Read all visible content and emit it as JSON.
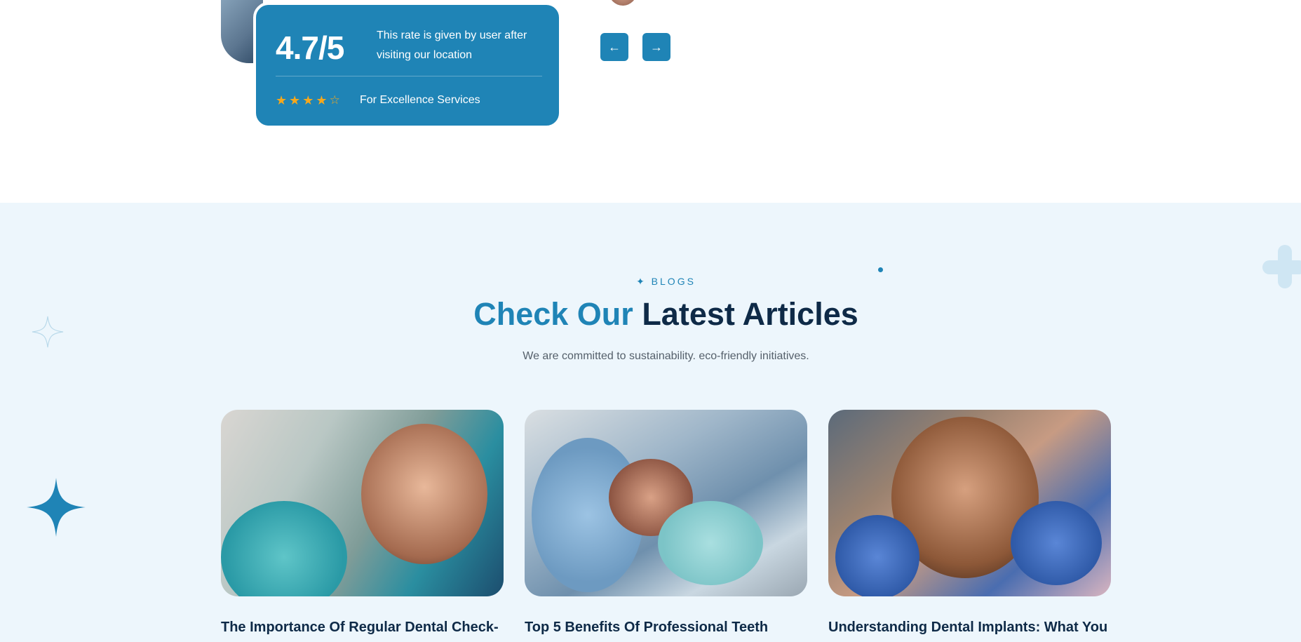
{
  "rating": {
    "value": "4.7/5",
    "description": "This rate is given by user after visiting our location",
    "stars": [
      {
        "icon": "star-filled-icon",
        "glyph": "★"
      },
      {
        "icon": "star-filled-icon",
        "glyph": "★"
      },
      {
        "icon": "star-filled-icon",
        "glyph": "★"
      },
      {
        "icon": "star-filled-icon",
        "glyph": "★"
      },
      {
        "icon": "star-outline-icon",
        "glyph": "☆"
      }
    ],
    "stars_filled": 4,
    "stars_total": 5,
    "caption": "For Excellence Services"
  },
  "slider": {
    "prev_icon": "arrow-left-icon",
    "prev_glyph": "←",
    "next_icon": "arrow-right-icon",
    "next_glyph": "→"
  },
  "blogs": {
    "eyebrow": "✦ BLOGS",
    "heading_accent": "Check Our",
    "heading_rest": "Latest Articles",
    "subtext": "We are committed to sustainability. eco-friendly initiatives.",
    "cards": [
      {
        "title": "The Importance Of Regular Dental Check-"
      },
      {
        "title": "Top 5 Benefits Of Professional Teeth"
      },
      {
        "title": "Understanding Dental Implants: What You"
      }
    ]
  },
  "colors": {
    "accent": "#1f84b6",
    "heading": "#0e2a47",
    "section_bg": "#edf6fc",
    "star": "#f6a81c"
  }
}
